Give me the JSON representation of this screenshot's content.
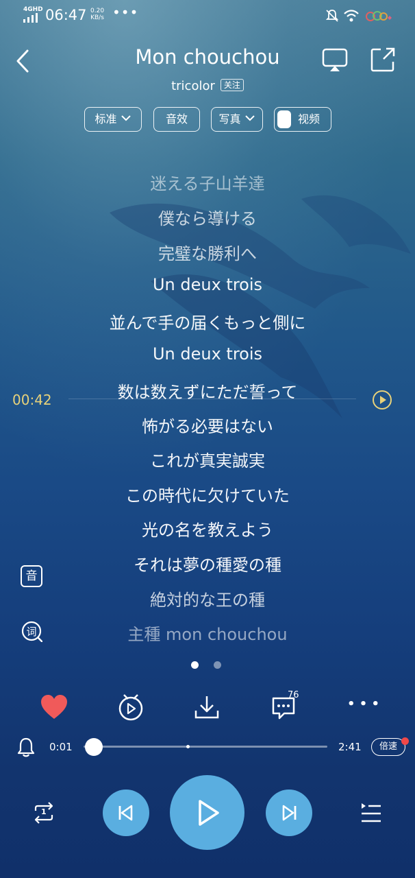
{
  "status_bar": {
    "network": "4GHD",
    "time": "06:47",
    "speed_value": "0.20",
    "speed_unit": "KB/s",
    "more": "•••"
  },
  "header": {
    "title": "Mon chouchou",
    "artist": "tricolor",
    "follow_label": "关注"
  },
  "options": {
    "quality_label": "标准",
    "effects_label": "音效",
    "photo_label": "写真",
    "video_label": "视频"
  },
  "lyrics": [
    "迷える子山羊達",
    "僕なら導ける",
    "完璧な勝利へ",
    "Un deux trois",
    "並んで手の届くもっと側に",
    "Un deux trois",
    "数は数えずにただ誓って",
    "怖がる必要はない",
    "これが真実誠実",
    "この時代に欠けていた",
    "光の名を教えよう",
    "それは夢の種愛の種",
    "絶対的な王の種",
    "主種 mon chouchou"
  ],
  "seek": {
    "time": "00:42"
  },
  "side_buttons": {
    "sound_label": "音"
  },
  "actions": {
    "comment_count": "76",
    "more": "• • •"
  },
  "player": {
    "elapsed": "0:01",
    "duration": "2:41",
    "progress": 0.006,
    "speed_label": "倍速",
    "repeat_badge": "1"
  },
  "colors": {
    "accent_time": "#e8d27a",
    "heart": "#f05a5a",
    "button_blue": "#5aaee0",
    "badge_red": "#f04848"
  }
}
